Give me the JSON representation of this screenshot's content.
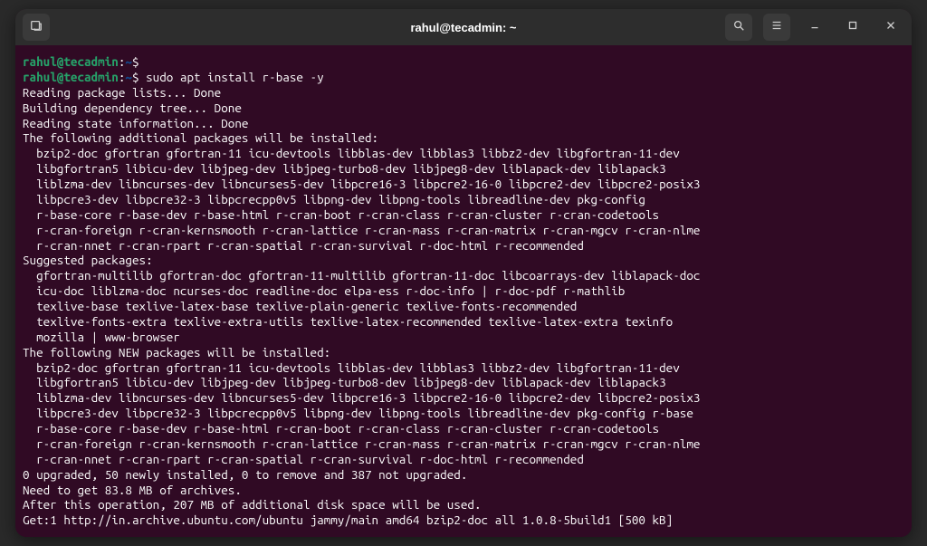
{
  "window": {
    "title": "rahul@tecadmin: ~"
  },
  "prompt": {
    "user_host": "rahul@tecadmin",
    "path": "~",
    "dollar": "$"
  },
  "command": "sudo apt install r-base -y",
  "output": {
    "l1": "Reading package lists... Done",
    "l2": "Building dependency tree... Done",
    "l3": "Reading state information... Done",
    "l4": "The following additional packages will be installed:",
    "l5": "  bzip2-doc gfortran gfortran-11 icu-devtools libblas-dev libblas3 libbz2-dev libgfortran-11-dev",
    "l6": "  libgfortran5 libicu-dev libjpeg-dev libjpeg-turbo8-dev libjpeg8-dev liblapack-dev liblapack3",
    "l7": "  liblzma-dev libncurses-dev libncurses5-dev libpcre16-3 libpcre2-16-0 libpcre2-dev libpcre2-posix3",
    "l8": "  libpcre3-dev libpcre32-3 libpcrecpp0v5 libpng-dev libpng-tools libreadline-dev pkg-config",
    "l9": "  r-base-core r-base-dev r-base-html r-cran-boot r-cran-class r-cran-cluster r-cran-codetools",
    "l10": "  r-cran-foreign r-cran-kernsmooth r-cran-lattice r-cran-mass r-cran-matrix r-cran-mgcv r-cran-nlme",
    "l11": "  r-cran-nnet r-cran-rpart r-cran-spatial r-cran-survival r-doc-html r-recommended",
    "l12": "Suggested packages:",
    "l13": "  gfortran-multilib gfortran-doc gfortran-11-multilib gfortran-11-doc libcoarrays-dev liblapack-doc",
    "l14": "  icu-doc liblzma-doc ncurses-doc readline-doc elpa-ess r-doc-info | r-doc-pdf r-mathlib",
    "l15": "  texlive-base texlive-latex-base texlive-plain-generic texlive-fonts-recommended",
    "l16": "  texlive-fonts-extra texlive-extra-utils texlive-latex-recommended texlive-latex-extra texinfo",
    "l17": "  mozilla | www-browser",
    "l18": "The following NEW packages will be installed:",
    "l19": "  bzip2-doc gfortran gfortran-11 icu-devtools libblas-dev libblas3 libbz2-dev libgfortran-11-dev",
    "l20": "  libgfortran5 libicu-dev libjpeg-dev libjpeg-turbo8-dev libjpeg8-dev liblapack-dev liblapack3",
    "l21": "  liblzma-dev libncurses-dev libncurses5-dev libpcre16-3 libpcre2-16-0 libpcre2-dev libpcre2-posix3",
    "l22": "  libpcre3-dev libpcre32-3 libpcrecpp0v5 libpng-dev libpng-tools libreadline-dev pkg-config r-base",
    "l23": "  r-base-core r-base-dev r-base-html r-cran-boot r-cran-class r-cran-cluster r-cran-codetools",
    "l24": "  r-cran-foreign r-cran-kernsmooth r-cran-lattice r-cran-mass r-cran-matrix r-cran-mgcv r-cran-nlme",
    "l25": "  r-cran-nnet r-cran-rpart r-cran-spatial r-cran-survival r-doc-html r-recommended",
    "l26": "0 upgraded, 50 newly installed, 0 to remove and 387 not upgraded.",
    "l27": "Need to get 83.8 MB of archives.",
    "l28": "After this operation, 207 MB of additional disk space will be used.",
    "l29": "Get:1 http://in.archive.ubuntu.com/ubuntu jammy/main amd64 bzip2-doc all 1.0.8-5build1 [500 kB]"
  }
}
